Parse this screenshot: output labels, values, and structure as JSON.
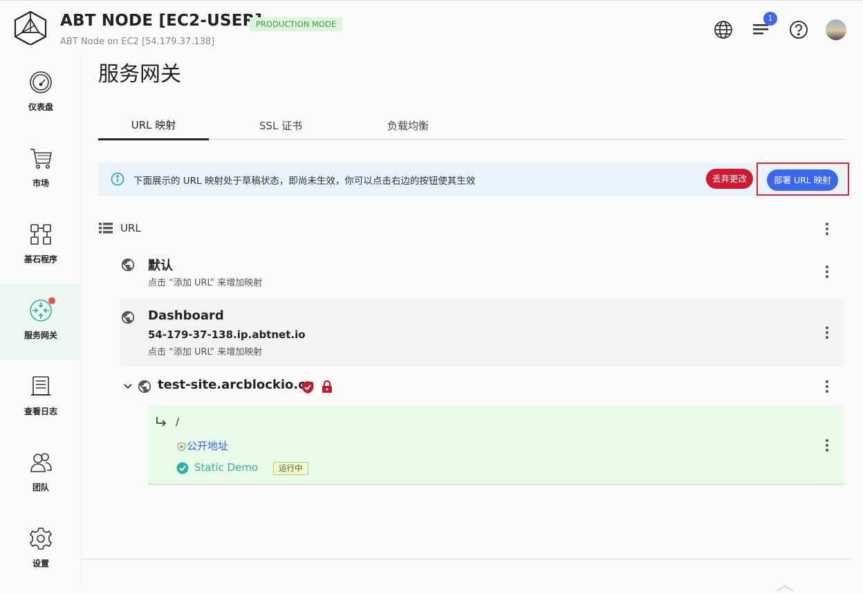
{
  "header": {
    "title": "ABT NODE [EC2-USER]",
    "mode_badge": "PRODUCTION MODE",
    "subtitle": "ABT Node on EC2 [54.179.37.138]",
    "notification_count": "1",
    "icons": [
      "globe-icon",
      "notifications-icon",
      "help-icon",
      "avatar"
    ]
  },
  "sidebar": {
    "items": [
      {
        "label": "仪表盘",
        "icon": "dashboard-gauge-icon"
      },
      {
        "label": "市场",
        "icon": "cart-icon"
      },
      {
        "label": "基石程序",
        "icon": "blocklets-icon"
      },
      {
        "label": "服务网关",
        "icon": "gateway-icon",
        "active": true,
        "has_dot": true
      },
      {
        "label": "查看日志",
        "icon": "logs-icon"
      },
      {
        "label": "团队",
        "icon": "team-icon"
      },
      {
        "label": "设置",
        "icon": "settings-gear-icon"
      }
    ]
  },
  "main": {
    "page_title": "服务网关",
    "tabs": [
      {
        "label": "URL 映射",
        "active": true
      },
      {
        "label": "SSL 证书"
      },
      {
        "label": "负载均衡"
      }
    ],
    "alert": {
      "text": "下面展示的 URL 映射处于草稿状态，即尚未生效，你可以点击右边的按钮使其生效",
      "discard_label": "丢弃更改",
      "deploy_label": "部署 URL 映射"
    },
    "url_section_label": "URL",
    "sites": [
      {
        "name": "默认",
        "hint": "点击 “添加 URL” 来增加映射"
      },
      {
        "name": "Dashboard",
        "domain": "54-179-37-138.ip.abtnet.io",
        "hint": "点击 “添加 URL” 来增加映射"
      },
      {
        "name": "test-site.arcblockio.cn"
      }
    ],
    "route": {
      "path": "/",
      "public_label": "公开地址",
      "app_name": "Static Demo",
      "status": "运行中"
    }
  },
  "colors": {
    "primary": "#3b66f0",
    "danger": "#d0182f",
    "success_bg": "#e8fbe9",
    "teal": "#2bb3a1",
    "badge_green_bg": "#dcf5dc"
  }
}
